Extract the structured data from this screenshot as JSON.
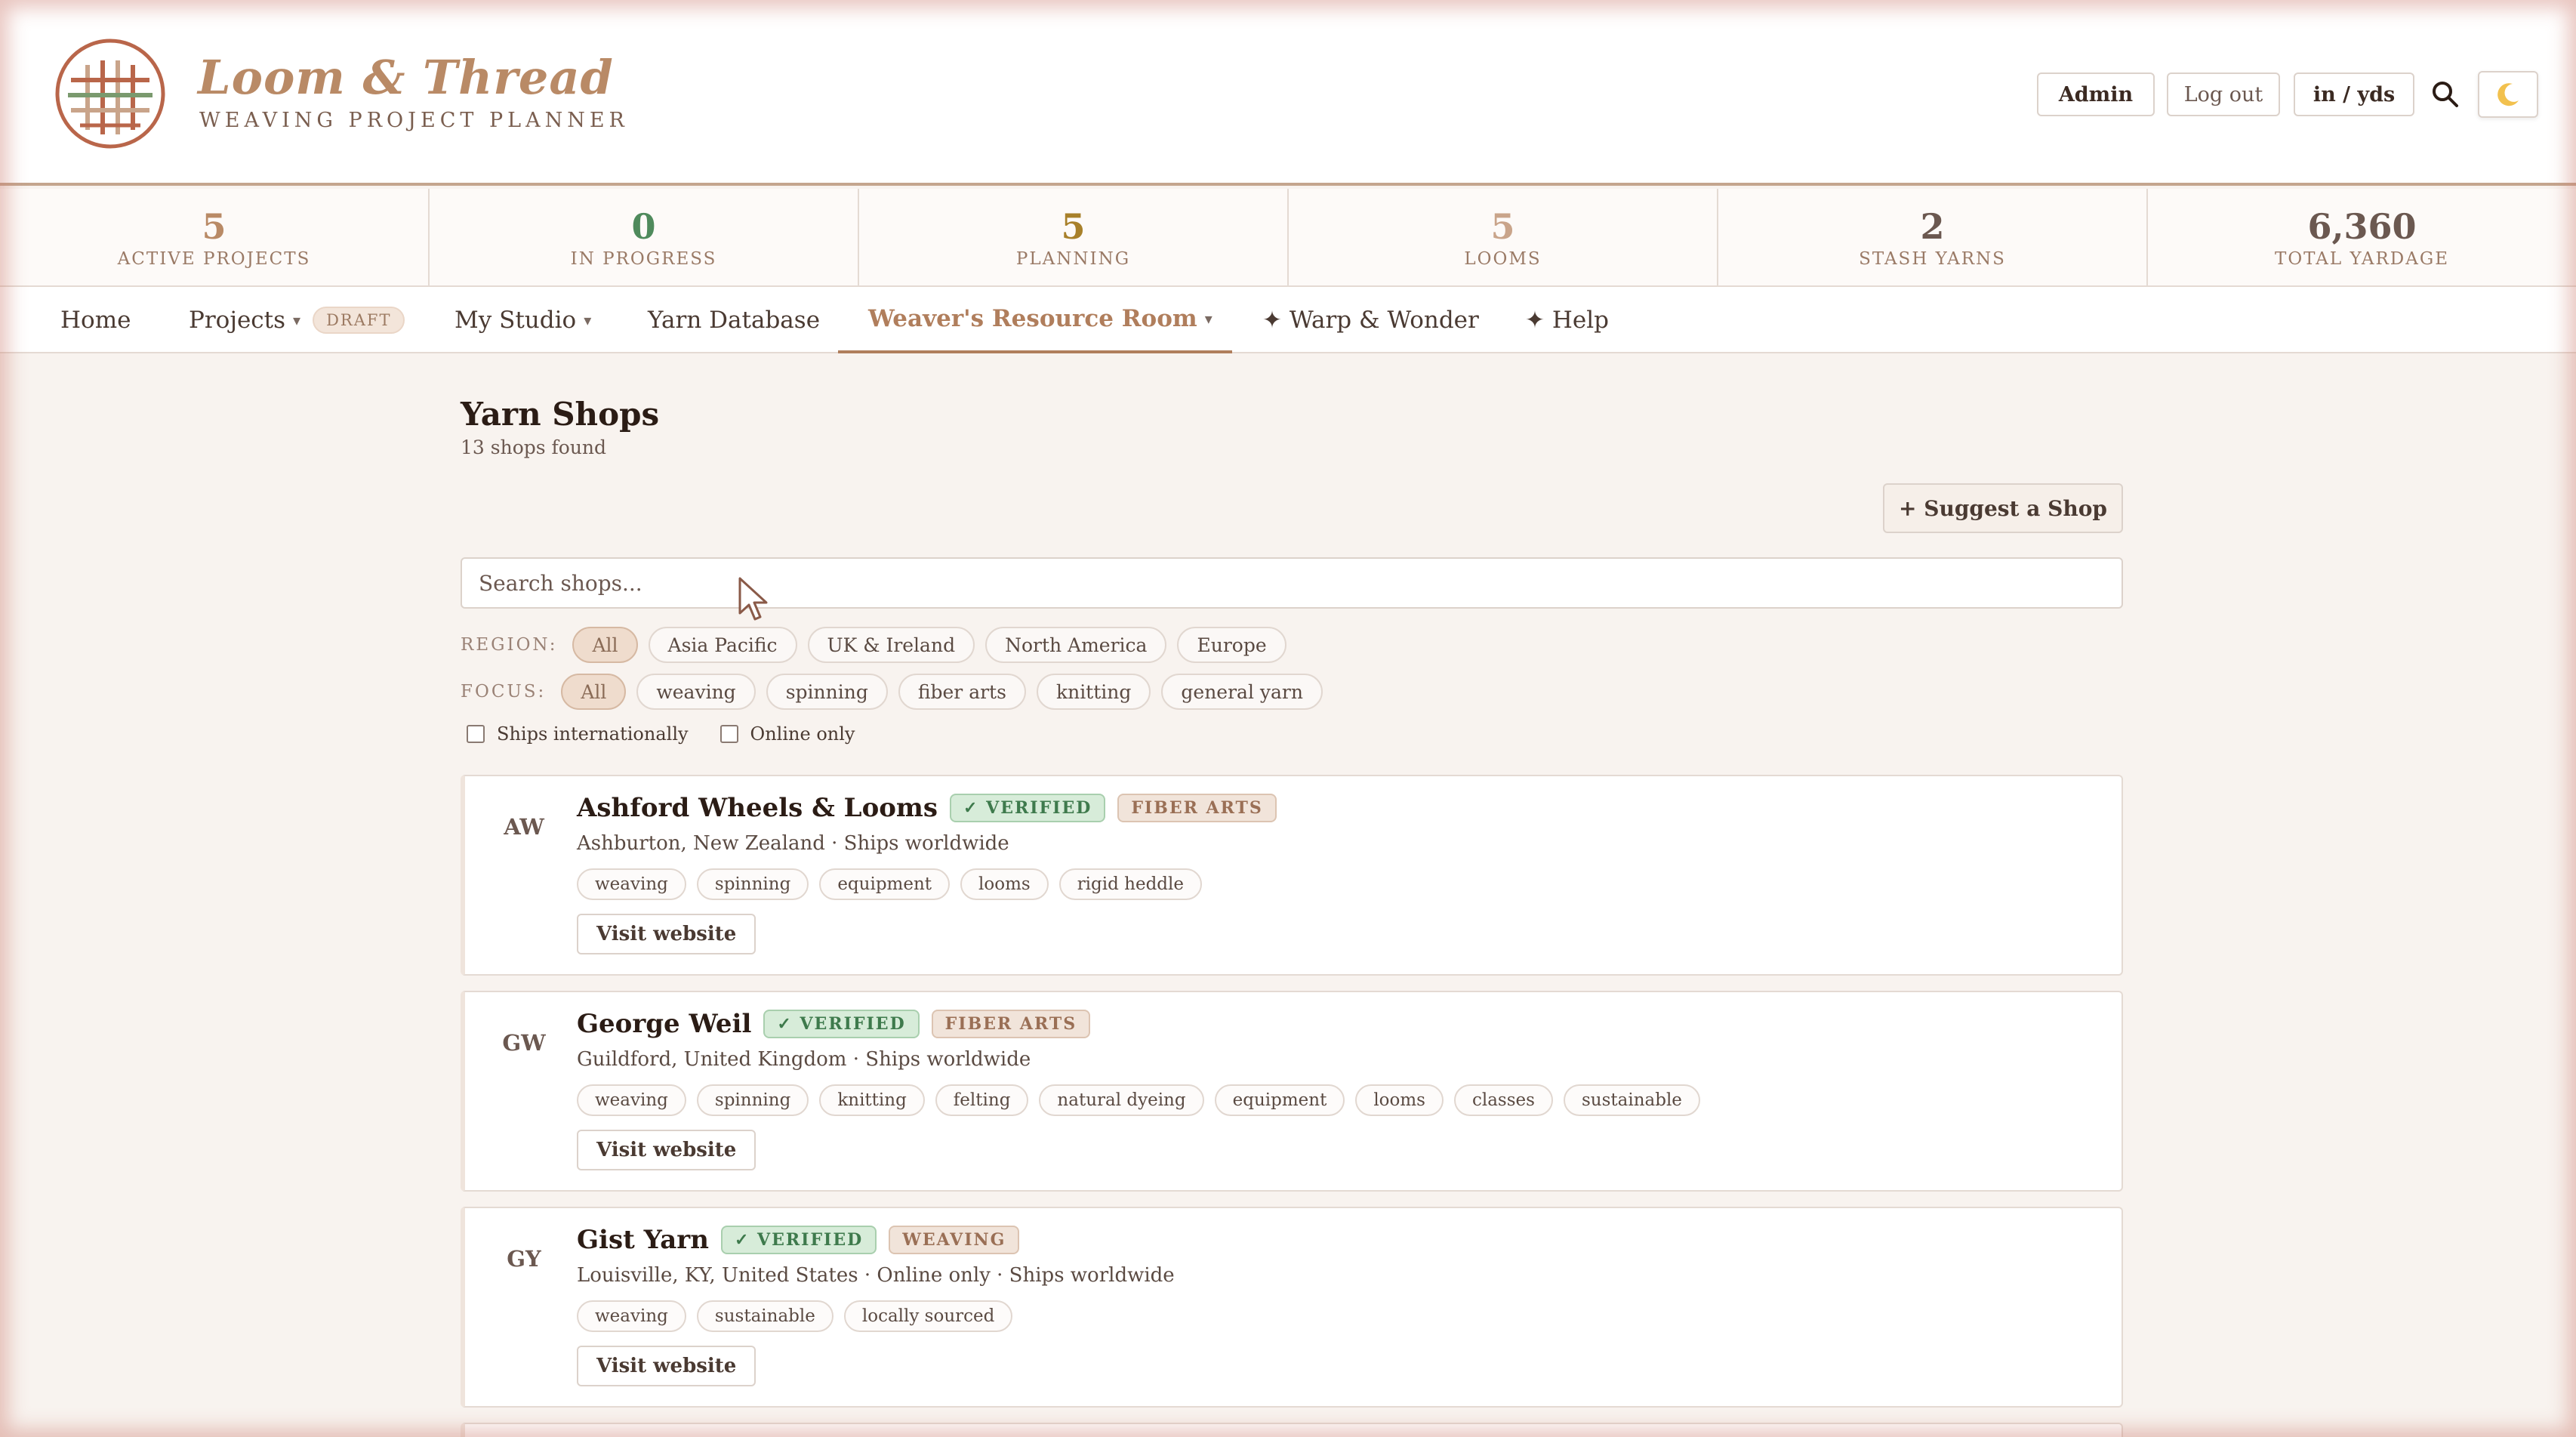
{
  "brand": {
    "title": "Loom & Thread",
    "subtitle": "WEAVING PROJECT PLANNER",
    "logo_icon": "loom-grid-logo"
  },
  "header_actions": {
    "admin": "Admin",
    "logout": "Log out",
    "units": "in / yds",
    "search_icon": "search-icon",
    "theme_icon": "moon-icon"
  },
  "stats": [
    {
      "value": "5",
      "label": "ACTIVE PROJECTS",
      "color": "#b98a66"
    },
    {
      "value": "0",
      "label": "IN PROGRESS",
      "color": "#4f8a5c"
    },
    {
      "value": "5",
      "label": "PLANNING",
      "color": "#a8802a"
    },
    {
      "value": "5",
      "label": "LOOMS",
      "color": "#c9a48a"
    },
    {
      "value": "2",
      "label": "STASH YARNS",
      "color": "#6b5850"
    },
    {
      "value": "6,360",
      "label": "TOTAL YARDAGE",
      "color": "#6b5850"
    }
  ],
  "nav": {
    "home": "Home",
    "projects": "Projects",
    "projects_badge": "DRAFT",
    "studio": "My Studio",
    "yarn_db": "Yarn Database",
    "resource_room": "Weaver's Resource Room",
    "warp_wonder": "✦ Warp & Wonder",
    "help": "✦ Help"
  },
  "page": {
    "title": "Yarn Shops",
    "count": "13 shops found",
    "suggest_button": "+ Suggest a Shop",
    "search_placeholder": "Search shops..."
  },
  "filters": {
    "region_label": "REGION:",
    "region_options": [
      "All",
      "Asia Pacific",
      "UK & Ireland",
      "North America",
      "Europe"
    ],
    "region_selected": "All",
    "focus_label": "FOCUS:",
    "focus_options": [
      "All",
      "weaving",
      "spinning",
      "fiber arts",
      "knitting",
      "general yarn"
    ],
    "focus_selected": "All",
    "ships_internationally": "Ships internationally",
    "online_only": "Online only"
  },
  "shops": [
    {
      "initials": "AW",
      "name": "Ashford Wheels & Looms",
      "verified": "✓ VERIFIED",
      "focus": "FIBER ARTS",
      "meta": "Ashburton, New Zealand · Ships worldwide",
      "tags": [
        "weaving",
        "spinning",
        "equipment",
        "looms",
        "rigid heddle"
      ],
      "visit": "Visit website"
    },
    {
      "initials": "GW",
      "name": "George Weil",
      "verified": "✓ VERIFIED",
      "focus": "FIBER ARTS",
      "meta": "Guildford, United Kingdom · Ships worldwide",
      "tags": [
        "weaving",
        "spinning",
        "knitting",
        "felting",
        "natural dyeing",
        "equipment",
        "looms",
        "classes",
        "sustainable"
      ],
      "visit": "Visit website"
    },
    {
      "initials": "GY",
      "name": "Gist Yarn",
      "verified": "✓ VERIFIED",
      "focus": "WEAVING",
      "meta": "Louisville, KY, United States · Online only · Ships worldwide",
      "tags": [
        "weaving",
        "sustainable",
        "locally sourced"
      ],
      "visit": "Visit website"
    }
  ]
}
